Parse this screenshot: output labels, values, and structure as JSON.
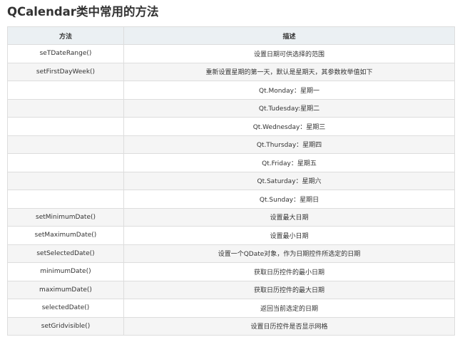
{
  "title": "QCalendar类中常用的方法",
  "table": {
    "headers": [
      "方法",
      "描述"
    ],
    "rows": [
      {
        "method": "seTDateRange()",
        "desc": "设置日期可供选择的范围"
      },
      {
        "method": "setFirstDayWeek()",
        "desc": "重新设置星期的第一天，默认是星期天，其参数枚举值如下"
      },
      {
        "method": "",
        "desc": "Qt.Monday：星期一"
      },
      {
        "method": "",
        "desc": "Qt.Tudesday:星期二"
      },
      {
        "method": "",
        "desc": "Qt.Wednesday：星期三"
      },
      {
        "method": "",
        "desc": "Qt.Thursday：星期四"
      },
      {
        "method": "",
        "desc": "Qt.Friday：星期五"
      },
      {
        "method": "",
        "desc": "Qt.Saturday：星期六"
      },
      {
        "method": "",
        "desc": "Qt.Sunday：星期日"
      },
      {
        "method": "setMinimumDate()",
        "desc": "设置最大日期"
      },
      {
        "method": "setMaximumDate()",
        "desc": "设置最小日期"
      },
      {
        "method": "setSelectedDate()",
        "desc": "设置一个QDate对象，作为日期控件所选定的日期"
      },
      {
        "method": "minimumDate()",
        "desc": "获取日历控件的最小日期"
      },
      {
        "method": "maximumDate()",
        "desc": "获取日历控件的最大日期"
      },
      {
        "method": "selectedDate()",
        "desc": "返回当前选定的日期"
      },
      {
        "method": "setGridvisible()",
        "desc": "设置日历控件是否显示网格"
      }
    ]
  }
}
